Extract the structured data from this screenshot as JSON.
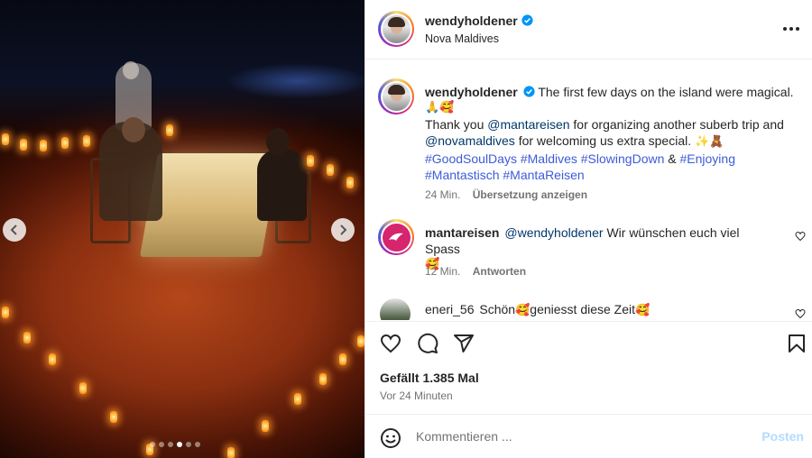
{
  "post": {
    "photo_alt": "Candlelit dinner on the beach",
    "carousel": {
      "dots": 6,
      "active_index": 3
    }
  },
  "header": {
    "username": "wendyholdener",
    "location": "Nova Maldives",
    "more_icon": "more-horizontal-icon"
  },
  "caption": {
    "username": "wendyholdener",
    "line1": "The first few days on the island were magical.",
    "line1_emoji": "🙏🥰",
    "thank_you": "Thank you",
    "mention1": "@mantareisen",
    "text2": "for organizing another suberb trip and",
    "mention2": "@novamaldives",
    "text3": "for welcoming us extra special.",
    "line3_emoji": "✨🧸",
    "hashtags_line4": [
      "#GoodSoulDays",
      "#Maldives",
      "#SlowingDown"
    ],
    "amp": "&",
    "hashtag_enjoying": "#Enjoying",
    "hashtags_line5": [
      "#Mantastisch",
      "#MantaReisen"
    ],
    "time": "24 Min.",
    "translate": "Übersetzung anzeigen"
  },
  "comments": [
    {
      "username": "mantareisen",
      "mention": "@wendyholdener",
      "text": "Wir wünschen euch viel Spass",
      "emoji": "🥰",
      "time": "12 Min.",
      "reply": "Antworten"
    },
    {
      "username": "eneri_56",
      "text_before": "Schön",
      "emoji1": "🥰",
      "text_after": "geniesst diese Zeit",
      "emoji2": "🥰"
    }
  ],
  "actions": {
    "like_icon": "heart-icon",
    "comment_icon": "comment-icon",
    "share_icon": "send-icon",
    "save_icon": "bookmark-icon",
    "likes": "Gefällt 1.385 Mal",
    "posted": "Vor 24 Minuten"
  },
  "composer": {
    "emoji_icon": "smiley-icon",
    "placeholder": "Kommentieren ...",
    "post_label": "Posten"
  },
  "colors": {
    "link": "#00376b",
    "hashtag": "#3d5bd8",
    "verified": "#0095f6",
    "post_button_disabled": "#b3dbff",
    "manta_avatar": "#d6246e"
  }
}
